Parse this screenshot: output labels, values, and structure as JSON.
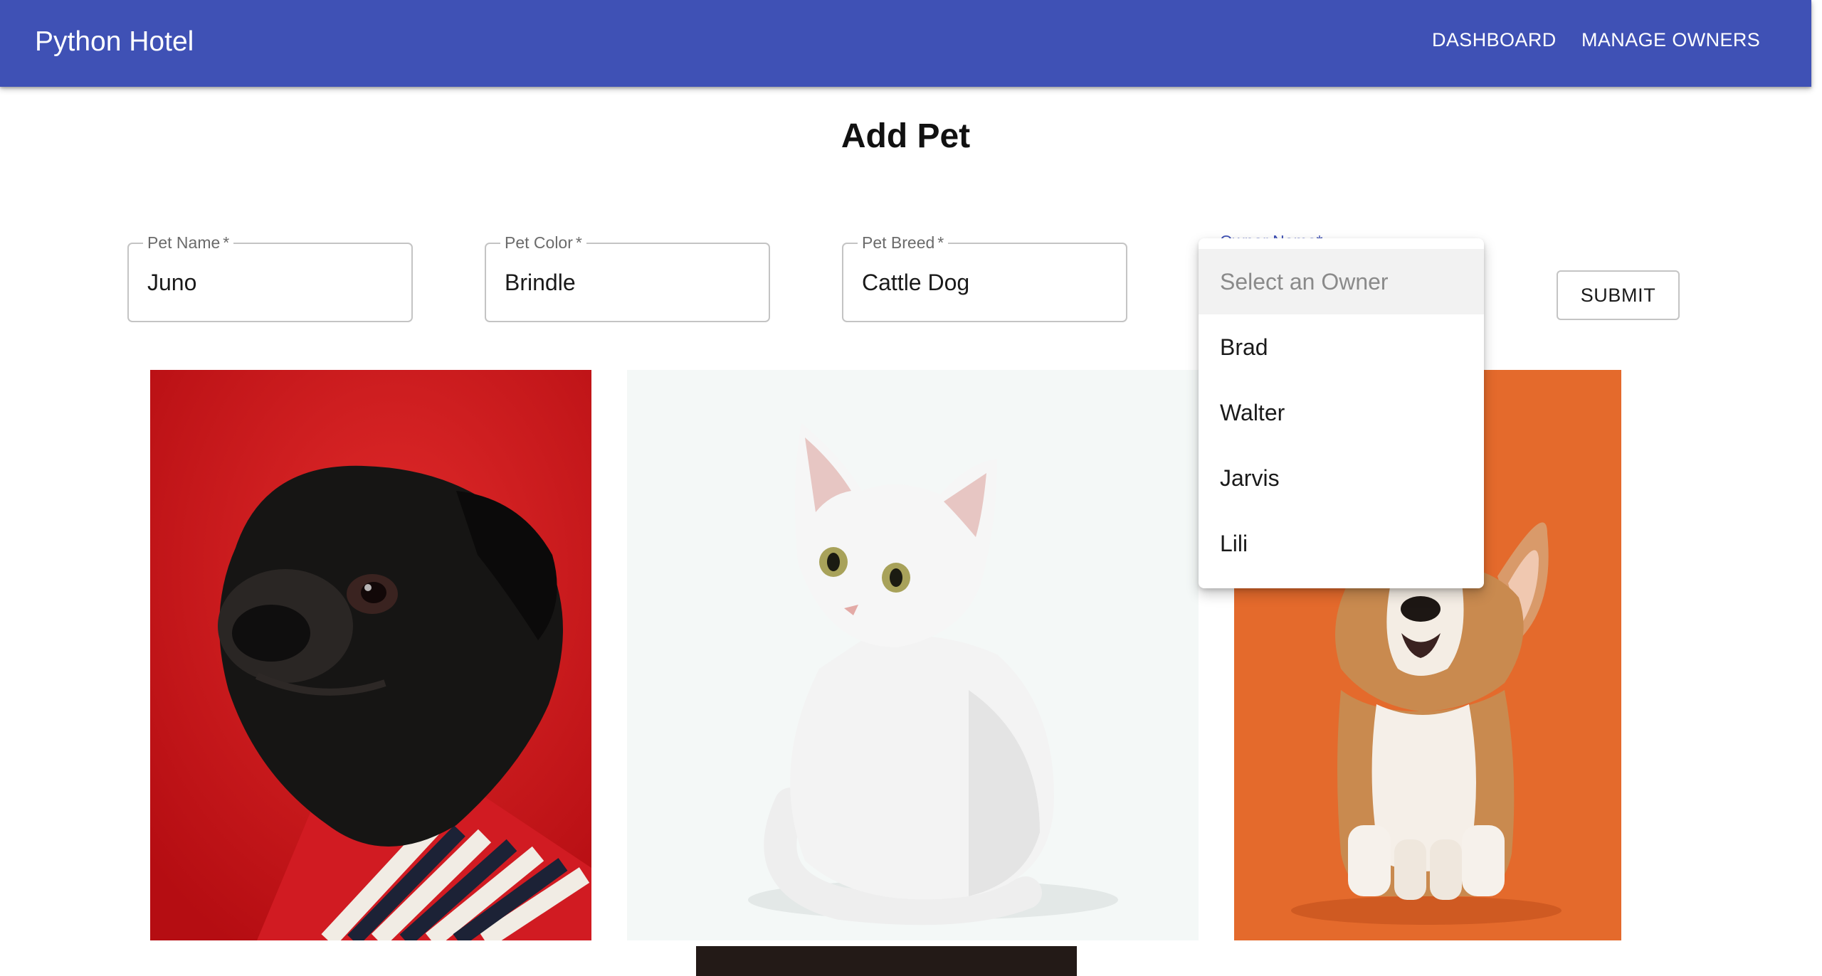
{
  "appbar": {
    "brand": "Python Hotel",
    "nav": [
      "DASHBOARD",
      "MANAGE OWNERS"
    ],
    "color": "#3f51b5"
  },
  "page": {
    "title": "Add Pet"
  },
  "form": {
    "pet_name": {
      "label": "Pet Name",
      "value": "Juno"
    },
    "pet_color": {
      "label": "Pet Color",
      "value": "Brindle"
    },
    "pet_breed": {
      "label": "Pet Breed",
      "value": "Cattle Dog"
    },
    "owner": {
      "label": "Owner Name",
      "placeholder": "Select an Owner",
      "options": [
        "Brad",
        "Walter",
        "Jarvis",
        "Lili"
      ]
    },
    "required_marker": "*",
    "submit": "SUBMIT"
  }
}
